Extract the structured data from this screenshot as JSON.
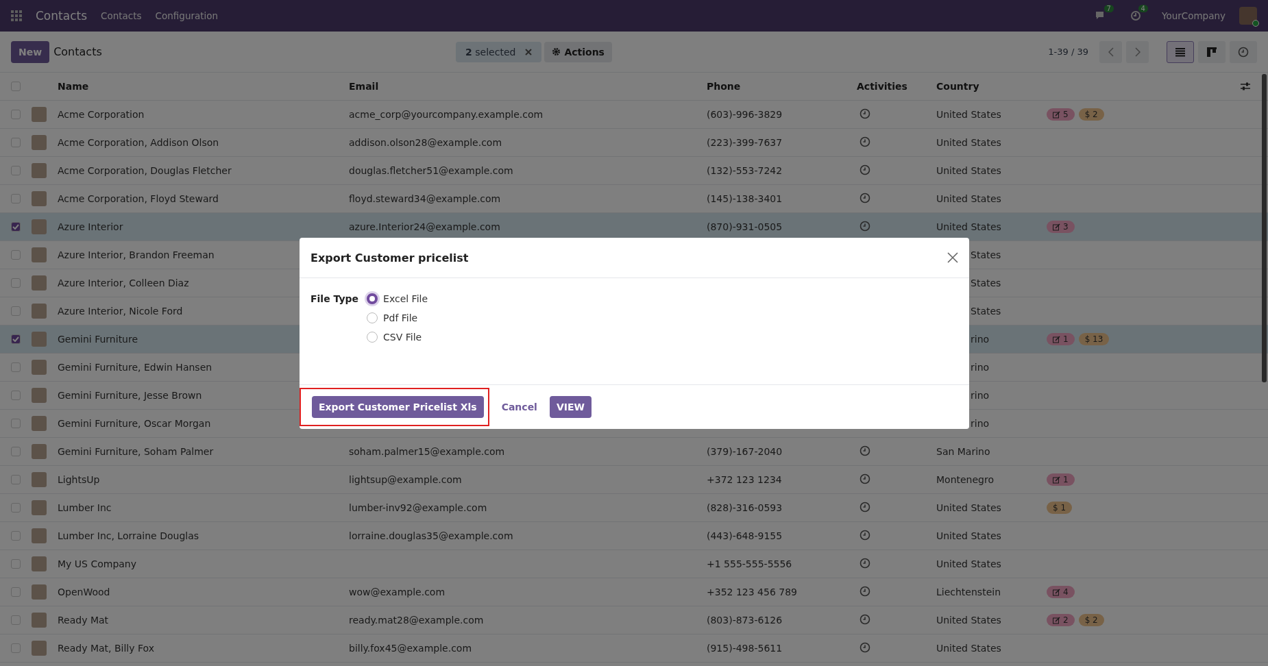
{
  "navbar": {
    "app": "Contacts",
    "menu": [
      "Contacts",
      "Configuration"
    ],
    "messages_count": "7",
    "activities_count": "4",
    "company": "YourCompany"
  },
  "control_bar": {
    "new_button": "New",
    "title": "Contacts",
    "selection": "**2** selected",
    "actions": "Actions",
    "pager": "1-39 / 39",
    "views": [
      {
        "kind": "list",
        "selected": true
      },
      {
        "kind": "kanban",
        "selected": false
      },
      {
        "kind": "activity",
        "selected": false
      }
    ]
  },
  "table": {
    "select_all_checked": false,
    "columns": [
      "Name",
      "Email",
      "Phone",
      "Activities",
      "Country"
    ],
    "rows": [
      {
        "name": "Acme Corporation",
        "email": "acme_corp@yourcompany.example.com",
        "phone": "(603)-996-3829",
        "country": "United States",
        "checked": false,
        "tags": [
          {
            "kind": "note",
            "label": "5"
          },
          {
            "kind": "money",
            "label": "$ 2"
          }
        ]
      },
      {
        "name": "Acme Corporation, Addison Olson",
        "email": "addison.olson28@example.com",
        "phone": "(223)-399-7637",
        "country": "United States",
        "checked": false,
        "tags": []
      },
      {
        "name": "Acme Corporation, Douglas Fletcher",
        "email": "douglas.fletcher51@example.com",
        "phone": "(132)-553-7242",
        "country": "United States",
        "checked": false,
        "tags": []
      },
      {
        "name": "Acme Corporation, Floyd Steward",
        "email": "floyd.steward34@example.com",
        "phone": "(145)-138-3401",
        "country": "United States",
        "checked": false,
        "tags": []
      },
      {
        "name": "Azure Interior",
        "email": "azure.Interior24@example.com",
        "phone": "(870)-931-0505",
        "country": "United States",
        "checked": true,
        "tags": [
          {
            "kind": "note",
            "label": "3"
          }
        ]
      },
      {
        "name": "Azure Interior, Brandon Freeman",
        "country": "States",
        "checked": false,
        "tags": []
      },
      {
        "name": "Azure Interior, Colleen Diaz",
        "country": "States",
        "checked": false,
        "tags": []
      },
      {
        "name": "Azure Interior, Nicole Ford",
        "country": "States",
        "checked": false,
        "tags": []
      },
      {
        "name": "Gemini Furniture",
        "country": "rino",
        "checked": true,
        "tags": [
          {
            "kind": "note",
            "label": "1"
          },
          {
            "kind": "money",
            "label": "$ 13"
          }
        ]
      },
      {
        "name": "Gemini Furniture, Edwin Hansen",
        "country": "rino",
        "checked": false,
        "tags": []
      },
      {
        "name": "Gemini Furniture, Jesse Brown",
        "country": "rino",
        "checked": false,
        "tags": []
      },
      {
        "name": "Gemini Furniture, Oscar Morgan",
        "country": "rino",
        "checked": false,
        "tags": []
      },
      {
        "name": "Gemini Furniture, Soham Palmer",
        "email": "soham.palmer15@example.com",
        "phone": "(379)-167-2040",
        "country": "San Marino",
        "checked": false,
        "tags": []
      },
      {
        "name": "LightsUp",
        "email": "lightsup@example.com",
        "phone": "+372 123 1234",
        "country": "Montenegro",
        "checked": false,
        "tags": [
          {
            "kind": "note",
            "label": "1"
          }
        ]
      },
      {
        "name": "Lumber Inc",
        "email": "lumber-inv92@example.com",
        "phone": "(828)-316-0593",
        "country": "United States",
        "checked": false,
        "tags": [
          {
            "kind": "money",
            "label": "$ 1"
          }
        ]
      },
      {
        "name": "Lumber Inc, Lorraine Douglas",
        "email": "lorraine.douglas35@example.com",
        "phone": "(443)-648-9155",
        "country": "United States",
        "checked": false,
        "tags": []
      },
      {
        "name": "My US Company",
        "phone": "+1 555-555-5556",
        "country": "United States",
        "checked": false,
        "tags": []
      },
      {
        "name": "OpenWood",
        "email": "wow@example.com",
        "phone": "+352 123 456 789",
        "country": "Liechtenstein",
        "checked": false,
        "tags": [
          {
            "kind": "note",
            "label": "4"
          }
        ]
      },
      {
        "name": "Ready Mat",
        "email": "ready.mat28@example.com",
        "phone": "(803)-873-6126",
        "country": "United States",
        "checked": false,
        "tags": [
          {
            "kind": "note",
            "label": "2"
          },
          {
            "kind": "money",
            "label": "$ 2"
          }
        ]
      },
      {
        "name": "Ready Mat, Billy Fox",
        "email": "billy.fox45@example.com",
        "phone": "(915)-498-5611",
        "country": "United States",
        "checked": false,
        "tags": []
      }
    ]
  },
  "dialog": {
    "title": "Export Customer pricelist",
    "field_label": "File Type",
    "options": [
      {
        "label": "Excel File",
        "selected": true
      },
      {
        "label": "Pdf File",
        "selected": false
      },
      {
        "label": "CSV File",
        "selected": false
      }
    ],
    "buttons": [
      {
        "kind": "primary",
        "label": "Export Customer Pricelist Xls",
        "highlighted": true
      },
      {
        "kind": "link",
        "label": "Cancel",
        "highlighted": false
      },
      {
        "kind": "primary",
        "label": "VIEW",
        "highlighted": false
      }
    ]
  }
}
